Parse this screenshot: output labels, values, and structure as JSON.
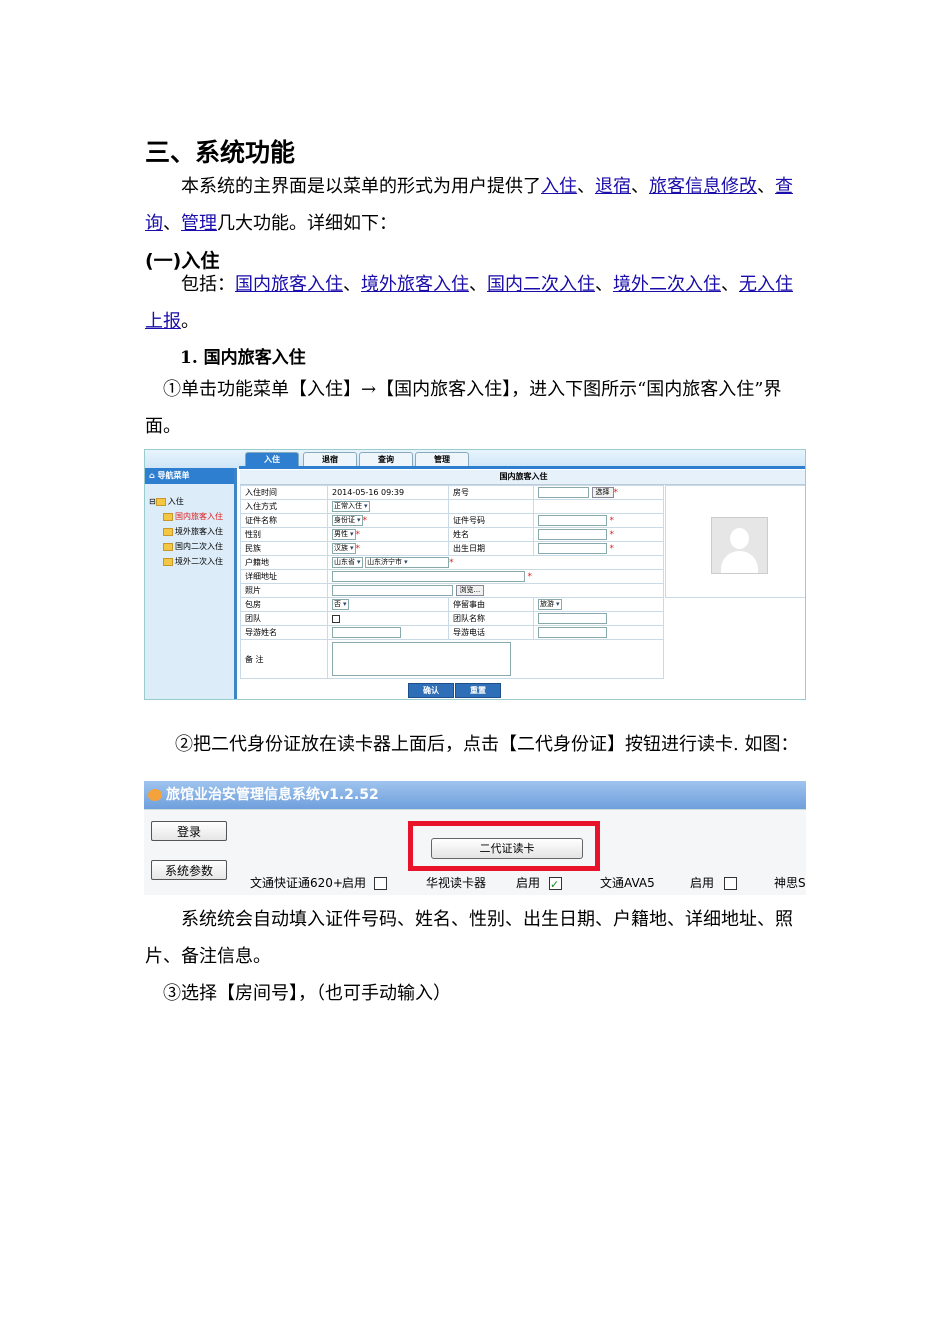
{
  "section": {
    "title": "三、系统功能"
  },
  "intro": {
    "prefix": "本系统的主界面是以菜单的形式为用户提供了",
    "links": [
      "入住",
      "退宿",
      "旅客信息修改",
      "查询",
      "管理"
    ],
    "sep": "、",
    "suffix": "几大功能。详细如下："
  },
  "subsection": {
    "title": "(一)入住"
  },
  "includes": {
    "prefix": "包括：",
    "links": [
      "国内旅客入住",
      "境外旅客入住",
      "国内二次入住",
      "境外二次入住",
      "无入住上报"
    ],
    "sep": "、",
    "suffix": "。"
  },
  "item1": {
    "title": "1. 国内旅客入住"
  },
  "step1": {
    "text": "①单击功能菜单【入住】→【国内旅客入住】，进入下图所示“国内旅客入住”界面。"
  },
  "shot1": {
    "tabs": [
      "入住",
      "退宿",
      "查询",
      "管理"
    ],
    "nav_title": "导航菜单",
    "tree_root": "入住",
    "tree_items": [
      "国内旅客入住",
      "境外旅客入住",
      "国内二次入住",
      "境外二次入住"
    ],
    "form_title": "国内旅客入住",
    "labels": {
      "checkin_time": "入住时间",
      "checkin_mode": "入住方式",
      "id_type": "证件名称",
      "gender": "性别",
      "ethnic": "民族",
      "domicile": "户籍地",
      "address": "详细地址",
      "photo": "照片",
      "charter": "包房",
      "team": "团队",
      "guide_name": "导游姓名",
      "remarks": "备 注",
      "room_no": "房号",
      "id_no": "证件号码",
      "name": "姓名",
      "birth": "出生日期",
      "stay_reason": "停留事由",
      "team_name": "团队名称",
      "guide_phone": "导游电话"
    },
    "values": {
      "checkin_time": "2014-05-16 09:39",
      "checkin_mode": "正常入住",
      "id_type": "身份证",
      "gender": "男性",
      "ethnic": "汉族",
      "province": "山东省",
      "city": "山东济宁市",
      "charter": "否",
      "stay_reason": "旅游"
    },
    "choose_btn": "选择",
    "browse_btn": "浏览...",
    "confirm_btn": "确认",
    "reset_btn": "重置",
    "required_mark": "*"
  },
  "step2": {
    "text": "②把二代身份证放在读卡器上面后，点击【二代身份证】按钮进行读卡. 如图："
  },
  "shot2": {
    "title": "旅馆业治安管理信息系统v1.2.52",
    "login_btn": "登录",
    "params_btn": "系统参数",
    "read_btn": "二代证读卡",
    "readers": [
      "文通快证通620+",
      "华视读卡器",
      "文通AVA5",
      "神思S"
    ],
    "enable_label": "启用"
  },
  "auto_fill": {
    "text": "系统统会自动填入证件号码、姓名、性别、出生日期、户籍地、详细地址、照片、备注信息。"
  },
  "step3": {
    "text": "③选择【房间号】，（也可手动输入）"
  }
}
